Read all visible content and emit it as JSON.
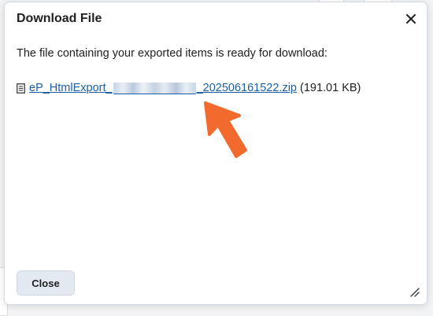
{
  "dialog": {
    "title": "Download File",
    "message": "The file containing your exported items is ready for download:",
    "file": {
      "name_prefix": "eP_HtmlExport_",
      "name_suffix": "_202506161522.zip",
      "size": "(191.01 KB)"
    },
    "close_button_label": "Close"
  },
  "colors": {
    "link": "#1b5ea8",
    "arrow": "#f26a2e",
    "button_bg": "#e3e9f1"
  },
  "icons": [
    "file-icon",
    "close-icon",
    "resize-handle-icon",
    "pointer-arrow"
  ]
}
